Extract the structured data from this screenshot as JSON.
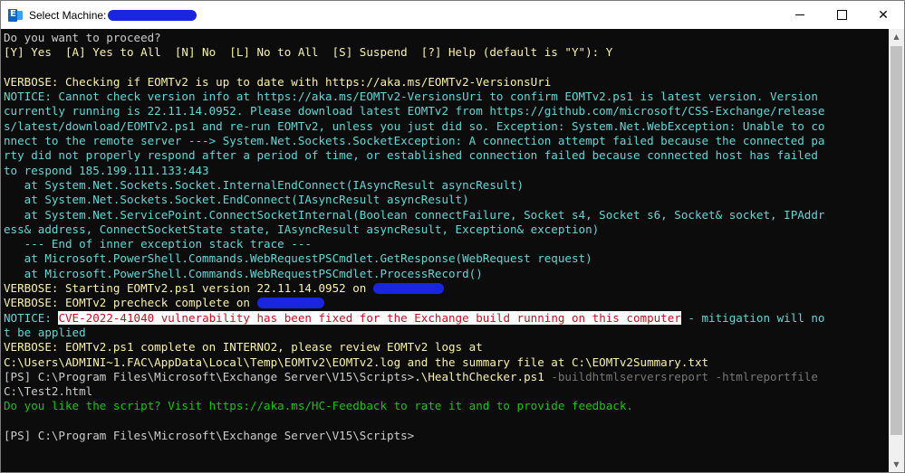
{
  "window": {
    "title": "Select Machine:",
    "controls": {
      "minimize": "",
      "maximize": "",
      "close": "✕"
    }
  },
  "console": {
    "lines": [
      "Do you want to proceed?",
      "[Y] Yes  [A] Yes to All  [N] No  [L] No to All  [S] Suspend  [?] Help (default is \"Y\"): Y",
      "",
      "VERBOSE: Checking if EOMTv2 is up to date with https://aka.ms/EOMTv2-VersionsUri",
      "NOTICE: Cannot check version info at https://aka.ms/EOMTv2-VersionsUri to confirm EOMTv2.ps1 is latest version. Version",
      "currently running is 22.11.14.0952. Please download latest EOMTv2 from https://github.com/microsoft/CSS-Exchange/release",
      "s/latest/download/EOMTv2.ps1 and re-run EOMTv2, unless you just did so. Exception: System.Net.WebException: Unable to co",
      "nnect to the remote server ---> System.Net.Sockets.SocketException: A connection attempt failed because the connected pa",
      "rty did not properly respond after a period of time, or established connection failed because connected host has failed",
      "to respond 185.199.111.133:443",
      "   at System.Net.Sockets.Socket.InternalEndConnect(IAsyncResult asyncResult)",
      "   at System.Net.Sockets.Socket.EndConnect(IAsyncResult asyncResult)",
      "   at System.Net.ServicePoint.ConnectSocketInternal(Boolean connectFailure, Socket s4, Socket s6, Socket& socket, IPAddr",
      "ess& address, ConnectSocketState state, IAsyncResult asyncResult, Exception& exception)",
      "   --- End of inner exception stack trace ---",
      "   at Microsoft.PowerShell.Commands.WebRequestPSCmdlet.GetResponse(WebRequest request)",
      "   at Microsoft.PowerShell.Commands.WebRequestPSCmdlet.ProcessRecord()",
      "VERBOSE: Starting EOMTv2.ps1 version 22.11.14.0952 on ",
      "VERBOSE: EOMTv2 precheck complete on "
    ],
    "notice_prefix": "NOTICE: ",
    "notice_highlight": "CVE-2022-41040 vulnerability has been fixed for the Exchange build running on this computer",
    "notice_suffix": " - mitigation will no",
    "notice_cont": "t be applied",
    "complete_line": "VERBOSE: EOMTv2.ps1 complete on INTERNO2, please review EOMTv2 logs at",
    "path_line": "C:\\Users\\ADMINI~1.FAC\\AppData\\Local\\Temp\\EOMTv2\\EOMTv2.log and the summary file at C:\\EOMTv2Summary.txt",
    "prompt1": "[PS] C:\\Program Files\\Microsoft\\Exchange Server\\V15\\Scripts>",
    "cmd": ".\\HealthChecker.ps1",
    "cmd_args": " -buildhtmlserversreport -htmlreportfile",
    "cmd_cont": "C:\\Test2.html",
    "feedback": "Do you like the script? Visit https://aka.ms/HC-Feedback to rate it and to provide feedback.",
    "prompt2": "[PS] C:\\Program Files\\Microsoft\\Exchange Server\\V15\\Scripts>"
  },
  "colors": {
    "background": "#0c0c0c",
    "default_text": "#cccccc",
    "verbose": "#f9f1a5",
    "notice": "#61d6d6",
    "stack": "#3a96dd",
    "feedback": "#16c60c",
    "highlight_text": "#c50f1f",
    "redaction": "#1a25e0"
  }
}
